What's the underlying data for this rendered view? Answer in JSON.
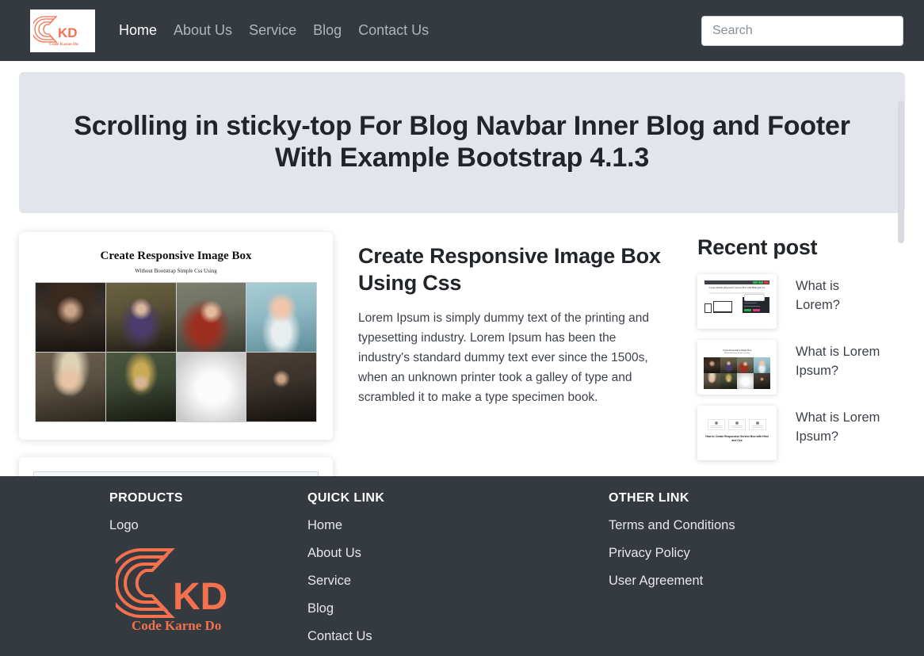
{
  "navbar": {
    "brand_alt": "CKD Code Karne Do logo",
    "links": [
      {
        "label": "Home",
        "active": true
      },
      {
        "label": "About Us",
        "active": false
      },
      {
        "label": "Service",
        "active": false
      },
      {
        "label": "Blog",
        "active": false
      },
      {
        "label": "Contact Us",
        "active": false
      }
    ],
    "search": {
      "value": "",
      "placeholder": "Search"
    }
  },
  "hero": {
    "title": "Scrolling in sticky-top For Blog Navbar Inner Blog and Footer With Example Bootstrap 4.1.3"
  },
  "article": {
    "card_image": {
      "title": "Create Responsive Image Box",
      "subtitle": "Without Bootstrap Simple Css Using"
    },
    "title": "Create Responsive Image Box Using Css",
    "body": "Lorem Ipsum is simply dummy text of the printing and typesetting industry. Lorem Ipsum has been the industry's standard dummy text ever since the 1500s, when an unknown printer took a galley of type and scrambled it to make a type specimen book."
  },
  "sidebar": {
    "title": "Recent post",
    "posts": [
      {
        "label": "What is Lorem?",
        "thumb": "mobile-responsive-service-box-thumb"
      },
      {
        "label": "What is Lorem Ipsum?",
        "thumb": "image-grid-thumb"
      },
      {
        "label": "What is Lorem Ipsum?",
        "thumb": "service-box-thumb"
      }
    ],
    "thumb_captions": {
      "thumb1_title": "Create Mobile Responsive Service Box with Html and Css",
      "thumb2_title": "Create Responsive Image Box",
      "thumb2_sub": "Without Bootstrap Simple Css Using",
      "thumb3_caption": "How to Create Responsive Service Box with Html and Css"
    }
  },
  "footer": {
    "columns": [
      {
        "heading": "PRODUCTS",
        "items": [
          {
            "label": "Logo"
          }
        ],
        "logo_alt": "CKD Code Karne Do logo"
      },
      {
        "heading": "QUICK LINK",
        "items": [
          {
            "label": "Home"
          },
          {
            "label": "About Us"
          },
          {
            "label": "Service"
          },
          {
            "label": "Blog"
          },
          {
            "label": "Contact Us"
          }
        ]
      },
      {
        "heading": "OTHER LINK",
        "items": [
          {
            "label": "Terms and Conditions"
          },
          {
            "label": "Privacy Policy"
          },
          {
            "label": "User Agreement"
          }
        ]
      }
    ]
  },
  "colors": {
    "navbar_bg": "#343a40",
    "footer_bg": "#343a40",
    "hero_bg": "#e2e6ea",
    "brand_orange": "#f4714e",
    "text_dark": "#212529",
    "text_muted": "#adb5bd",
    "page_bg": "#ffffff"
  },
  "logo_text": {
    "mark": "CKD",
    "tagline": "Code Karne Do"
  }
}
